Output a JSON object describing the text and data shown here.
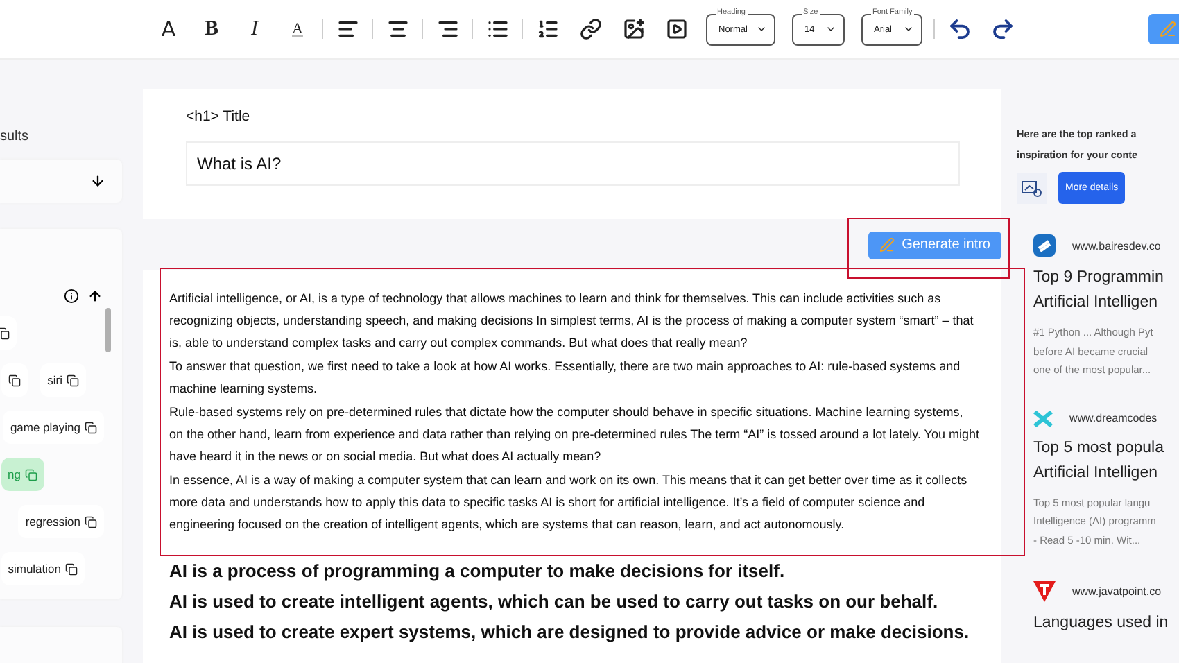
{
  "toolbar": {
    "text_buttons": [
      {
        "kind": "font",
        "label": "A"
      },
      {
        "kind": "bold",
        "label": "B"
      },
      {
        "kind": "italic",
        "label": "I"
      },
      {
        "kind": "color",
        "label": "A"
      }
    ],
    "icon_buttons": [
      {
        "kind": "align-left"
      },
      {
        "kind": "align-center"
      },
      {
        "kind": "align-right"
      },
      {
        "kind": "bullet-list"
      },
      {
        "kind": "numbered-list"
      },
      {
        "kind": "link"
      },
      {
        "kind": "image"
      },
      {
        "kind": "video"
      }
    ],
    "selects": [
      {
        "label": "Heading",
        "value": "Normal"
      },
      {
        "label": "Size",
        "value": "14"
      },
      {
        "label": "Font Family",
        "value": "Arial"
      }
    ]
  },
  "left_panel": {
    "heading": "sults",
    "chip_rows": [
      [
        {
          "selected": false
        }
      ],
      [
        {
          "selected": false
        },
        {
          "label": "siri",
          "selected": false
        }
      ],
      [
        {
          "label": "game playing",
          "selected": false
        }
      ],
      [
        {
          "label": "ng",
          "selected": true
        }
      ],
      [
        {
          "label": "regression",
          "selected": false
        }
      ],
      [
        {
          "label": "simulation",
          "selected": false
        }
      ]
    ]
  },
  "editor": {
    "title_label": "<h1> Title",
    "title_value": "What is AI?",
    "generate_button": "Generate intro",
    "intro_paragraphs": [
      "Artificial intelligence, or AI, is a type of technology that allows machines to learn and think for themselves. This can include activities such as recognizing objects, understanding speech, and making decisions In simplest terms, AI is the process of making a computer system “smart” – that is, able to understand complex tasks and carry out complex commands. But what does that really mean?",
      "To answer that question, we first need to take a look at how AI works. Essentially, there are two main approaches to AI: rule-based systems and machine learning systems.",
      "Rule-based systems rely on pre-determined rules that dictate how the computer should behave in specific situations. Machine learning systems, on the other hand, learn from experience and data rather than relying on pre-determined rules The term “AI” is tossed around a lot lately. You might have heard it in the news or on social media. But what does AI actually mean?",
      "In essence, AI is a way of making a computer system that can learn and work on its own. This means that it can get better over time as it collects more data and understands how to apply this data to specific tasks AI is short for artificial intelligence. It’s a field of computer science and engineering focused on the creation of intelligent agents, which are systems that can reason, learn, and act autonomously."
    ],
    "key_points": [
      "AI is a process of programming a computer to make decisions for itself.",
      "AI is used to create intelligent agents, which can be used to carry out tasks on our behalf.",
      "AI is used to create expert systems, which are designed to provide advice or make decisions."
    ]
  },
  "results_panel": {
    "intro_lines": [
      "Here are the top ranked a",
      "inspiration for your conte"
    ],
    "more_button": "More details",
    "results": [
      {
        "kind": "bairesdev",
        "site": "www.bairesdev.co",
        "title_lines": [
          "Top 9 Programmin",
          "Artificial Intelligen"
        ],
        "snippet_lines": [
          "#1 Python ... Although Pyt",
          "before AI became crucial",
          "one of the most popular..."
        ]
      },
      {
        "kind": "dreamcodes",
        "site": "www.dreamcodes",
        "title_lines": [
          "Top 5 most popula",
          "Artificial Intelligen"
        ],
        "snippet_lines": [
          "Top 5 most popular langu",
          "Intelligence (AI) programm",
          "- Read 5 -10 min. Wit..."
        ]
      },
      {
        "kind": "javatpoint",
        "site": "www.javatpoint.co",
        "title_lines": [
          "Languages used in"
        ]
      }
    ]
  }
}
